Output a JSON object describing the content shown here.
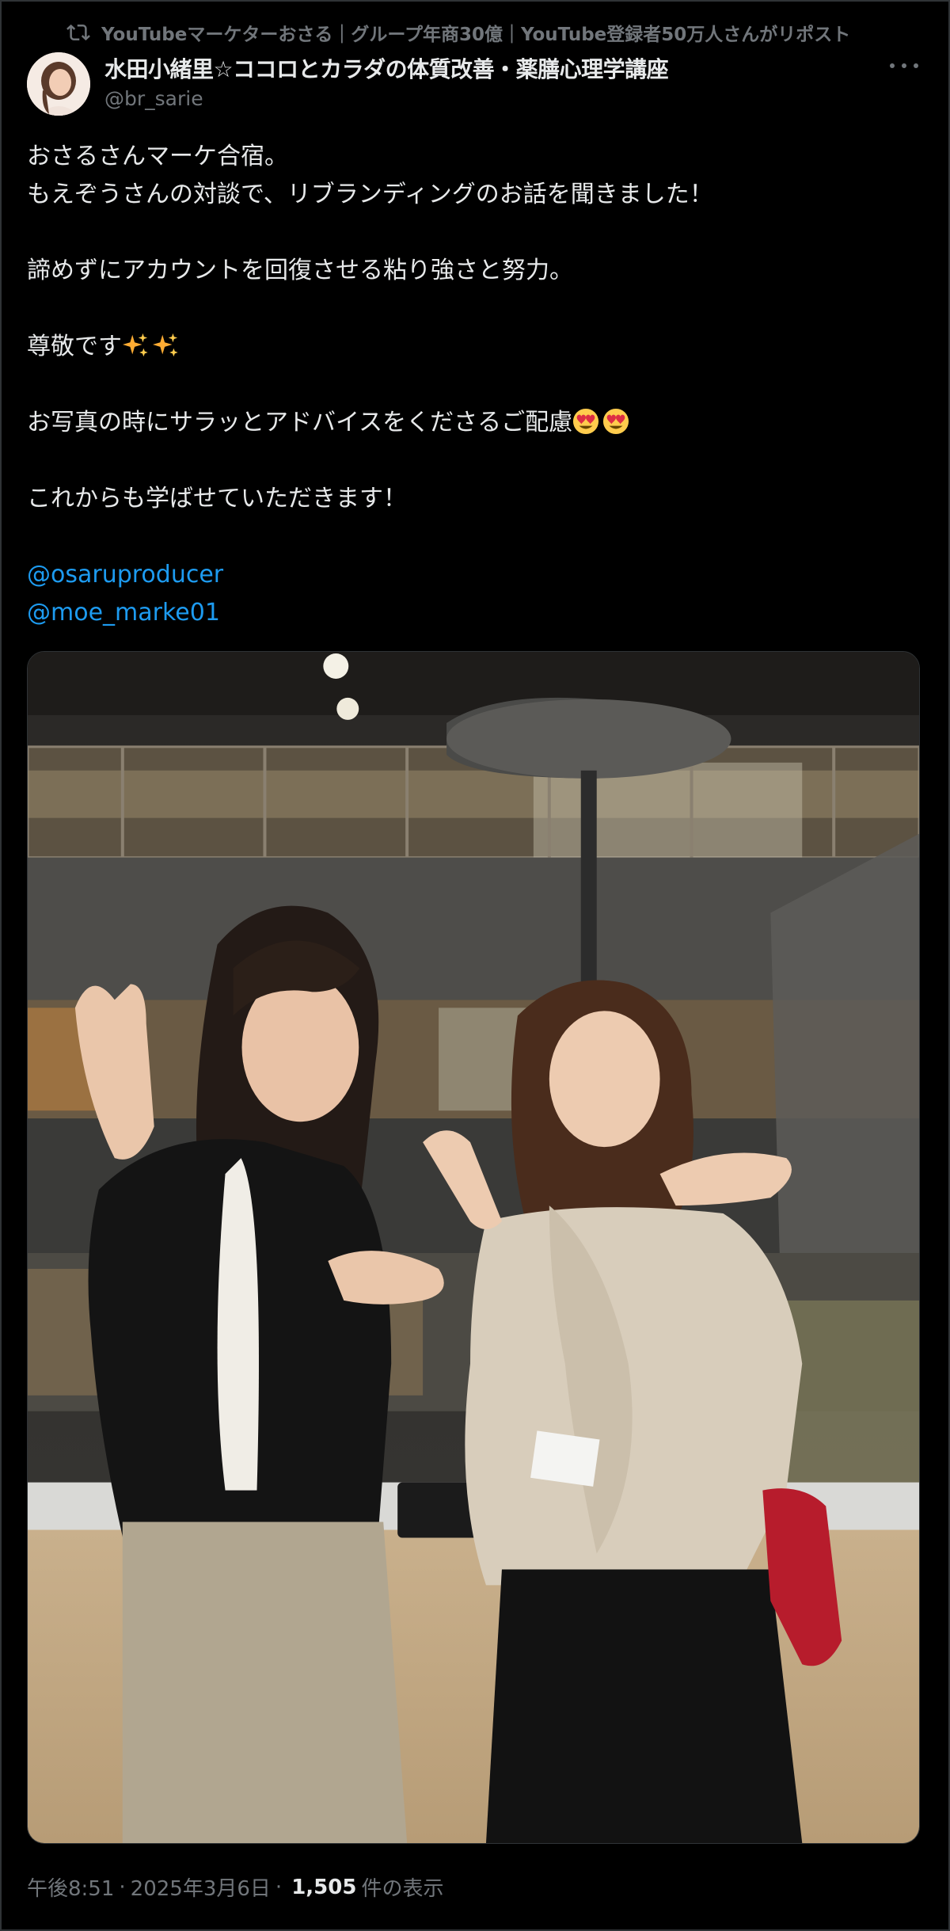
{
  "repost": {
    "text": "YouTubeマーケターおさる｜グループ年商30億｜YouTube登録者50万人さんがリポスト",
    "icon": "repost-icon"
  },
  "author": {
    "display_name": "水田小緒里☆ココロとカラダの体質改善・薬膳心理学講座",
    "handle": "@br_sarie"
  },
  "tweet": {
    "line1": "おさるさんマーケ合宿。",
    "line2": "もえぞうさんの対談で、リブランディングのお話を聞きました！",
    "line3": "諦めずにアカウントを回復させる粘り強さと努力。",
    "line4": "尊敬です",
    "line5": "お写真の時にサラッとアドバイスをくださるご配慮",
    "line6": "これからも学ばせていただきます！",
    "mention1": "@osaruproducer",
    "mention2": "@moe_marke01"
  },
  "meta": {
    "time": "午後8:51",
    "sep1": "·",
    "date": "2025年3月6日",
    "sep2": "·",
    "views_count": "1,505",
    "views_label": "件の表示"
  },
  "colors": {
    "background": "#000000",
    "text": "#e7e9ea",
    "muted": "#71767b",
    "link": "#1d9bf0"
  }
}
